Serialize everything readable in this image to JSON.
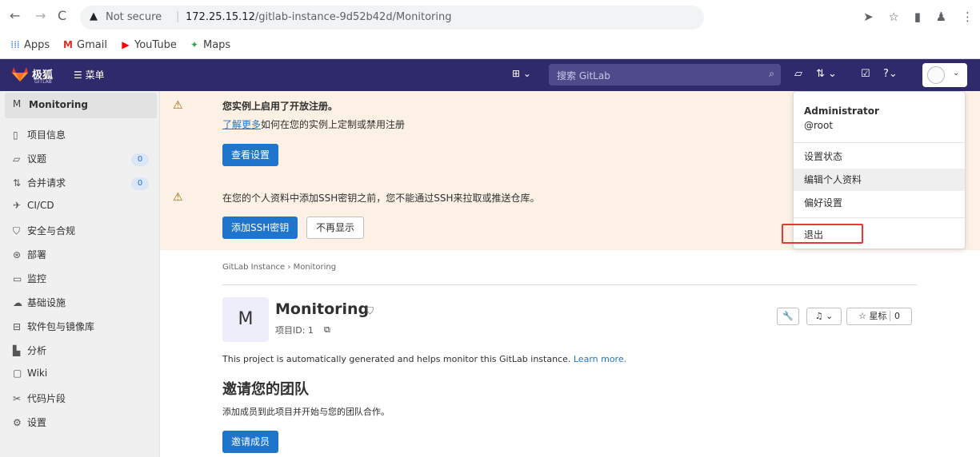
{
  "browser": {
    "not_secure": "Not secure",
    "url_host": "172.25.15.12",
    "url_path": "/gitlab-instance-9d52b42d/Monitoring",
    "bookmarks": [
      "Apps",
      "Gmail",
      "YouTube",
      "Maps"
    ]
  },
  "topnav": {
    "logo_text": "极狐",
    "logo_sub": "GITLAB",
    "menu_label": "菜单",
    "search_placeholder": "搜索 GitLab"
  },
  "sidebar": {
    "project_initial": "M",
    "project_name": "Monitoring",
    "items": [
      {
        "label": "项目信息",
        "icon": "info-icon"
      },
      {
        "label": "议题",
        "icon": "issues-icon",
        "badge": "0"
      },
      {
        "label": "合并请求",
        "icon": "merge-request-icon",
        "badge": "0"
      },
      {
        "label": "CI/CD",
        "icon": "rocket-icon"
      },
      {
        "label": "安全与合规",
        "icon": "shield-icon"
      },
      {
        "label": "部署",
        "icon": "deploy-icon"
      },
      {
        "label": "监控",
        "icon": "monitor-icon"
      },
      {
        "label": "基础设施",
        "icon": "cloud-icon"
      },
      {
        "label": "软件包与镜像库",
        "icon": "package-icon"
      },
      {
        "label": "分析",
        "icon": "chart-icon"
      },
      {
        "label": "Wiki",
        "icon": "book-icon"
      },
      {
        "label": "代码片段",
        "icon": "scissors-icon"
      },
      {
        "label": "设置",
        "icon": "gear-icon"
      }
    ]
  },
  "banner": {
    "title": "您实例上启用了开放注册。",
    "learn_more": "了解更多",
    "line_rest": "如何在您的实例上定制或禁用注册",
    "view_settings": "查看设置",
    "ssh_message": "在您的个人资料中添加SSH密钥之前，您不能通过SSH来拉取或推送仓库。",
    "add_ssh": "添加SSH密钥",
    "dont_show": "不再显示"
  },
  "main": {
    "breadcrumb_root": "GitLab Instance",
    "breadcrumb_sep": "›",
    "breadcrumb_current": "Monitoring",
    "project_initial": "M",
    "project_title": "Monitoring",
    "project_id": "项目ID: 1",
    "star_label": "星标",
    "star_count": "0",
    "description": "This project is automatically generated and helps monitor this GitLab instance.",
    "learn_more": "Learn more.",
    "invite_heading": "邀请您的团队",
    "invite_text": "添加成员到此项目并开始与您的团队合作。",
    "invite_button": "邀请成员"
  },
  "dropdown": {
    "name": "Administrator",
    "username": "@root",
    "items": [
      "设置状态",
      "编辑个人资料",
      "偏好设置"
    ],
    "signout": "退出"
  },
  "colors": {
    "nav_bg": "#2f2a6b",
    "primary": "#1f75cb",
    "banner_bg": "#fcf1e4",
    "highlight_box": "#e53935"
  }
}
